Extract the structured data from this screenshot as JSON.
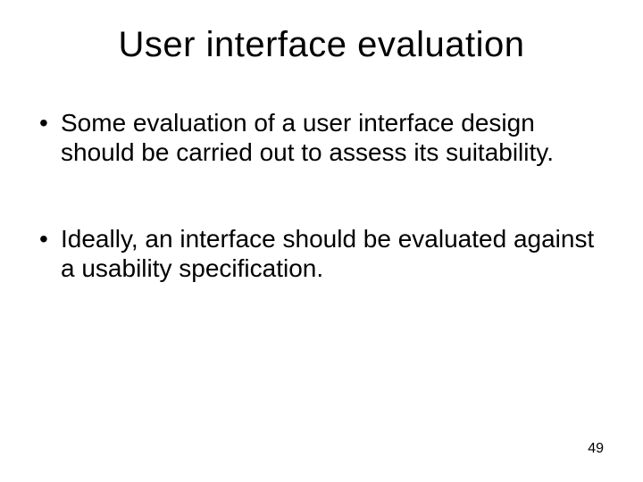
{
  "slide": {
    "title": "User interface evaluation",
    "bullets": [
      "Some evaluation of a user interface design should be carried out to assess its suitability.",
      "Ideally, an interface should be evaluated against a usability specification."
    ],
    "page_number": "49"
  }
}
